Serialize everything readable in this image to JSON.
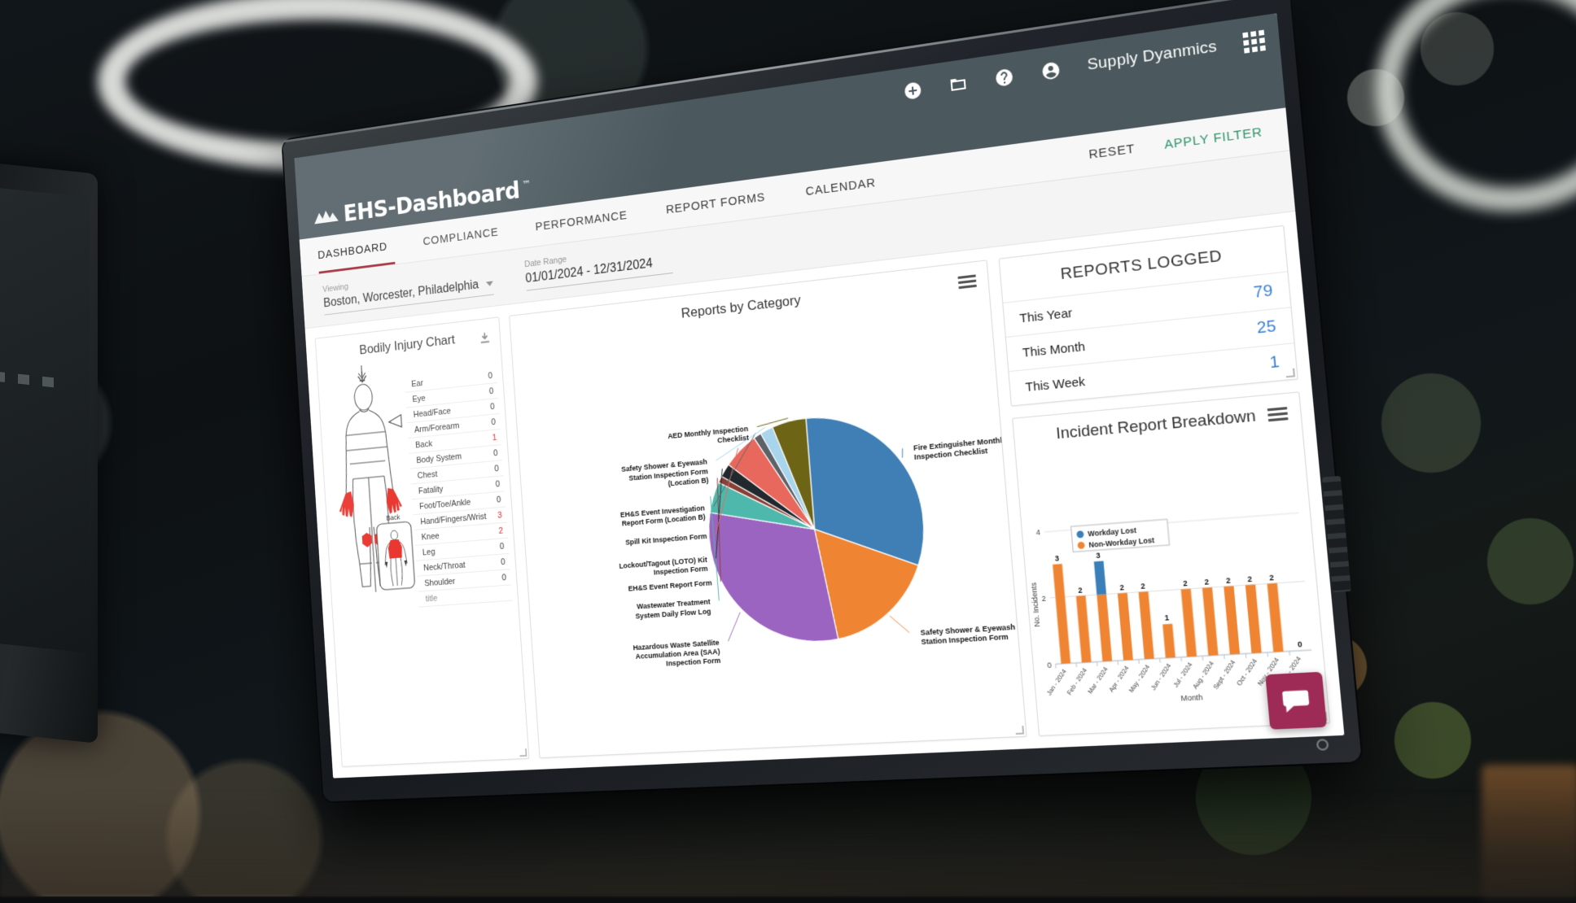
{
  "topbar": {
    "org_name": "Supply Dyanmics",
    "icons": [
      "add-circle-icon",
      "folder-icon",
      "help-circle-icon",
      "account-circle-icon",
      "apps-grid-icon"
    ]
  },
  "brand": {
    "name": "EHS-Dashboard",
    "tm": "™"
  },
  "nav": {
    "tabs": [
      {
        "label": "DASHBOARD",
        "active": true
      },
      {
        "label": "COMPLIANCE",
        "active": false
      },
      {
        "label": "PERFORMANCE",
        "active": false
      },
      {
        "label": "REPORT FORMS",
        "active": false
      },
      {
        "label": "CALENDAR",
        "active": false
      }
    ],
    "reset_label": "RESET",
    "apply_label": "APPLY FILTER"
  },
  "filters": {
    "viewing_label": "Viewing",
    "viewing_value": "Boston, Worcester, Philadelphia",
    "daterange_label": "Date Range",
    "daterange_value": "01/01/2024 - 12/31/2024"
  },
  "injury_card": {
    "title": "Bodily Injury Chart",
    "back_label": "Back",
    "footer_row": "title",
    "rows": [
      {
        "part": "Ear",
        "count": "0",
        "hot": false
      },
      {
        "part": "Eye",
        "count": "0",
        "hot": false
      },
      {
        "part": "Head/Face",
        "count": "0",
        "hot": false
      },
      {
        "part": "Arm/Forearm",
        "count": "0",
        "hot": false
      },
      {
        "part": "Back",
        "count": "1",
        "hot": true
      },
      {
        "part": "Body System",
        "count": "0",
        "hot": false
      },
      {
        "part": "Chest",
        "count": "0",
        "hot": false
      },
      {
        "part": "Fatality",
        "count": "0",
        "hot": false
      },
      {
        "part": "Foot/Toe/Ankle",
        "count": "0",
        "hot": false
      },
      {
        "part": "Hand/Fingers/Wrist",
        "count": "3",
        "hot": true
      },
      {
        "part": "Knee",
        "count": "2",
        "hot": true
      },
      {
        "part": "Leg",
        "count": "0",
        "hot": false
      },
      {
        "part": "Neck/Throat",
        "count": "0",
        "hot": false
      },
      {
        "part": "Shoulder",
        "count": "0",
        "hot": false
      }
    ]
  },
  "reports_logged": {
    "title": "REPORTS LOGGED",
    "rows": [
      {
        "label": "This Year",
        "value": "79"
      },
      {
        "label": "This Month",
        "value": "25"
      },
      {
        "label": "This Week",
        "value": "1"
      }
    ],
    "value_color": "#3a7fd5"
  },
  "chat": {
    "icon": "chat-bubble-icon",
    "color": "#9e2a56"
  },
  "chart_data": [
    {
      "id": "reports-by-category",
      "type": "pie",
      "title": "Reports by Category",
      "labels": [
        "Fire Extinguisher Monthly Inspection Checklist",
        "Safety Shower & Eyewash Station Inspection Form",
        "Hazardous Waste Satellite Accumulation Area (SAA) Inspection Form",
        "Wastewater Treatment System Daily Flow Log",
        "EH&S Event Report Form",
        "Lockout/Tagout (LOTO) Kit Inspection Form",
        "Spill Kit Inspection Form",
        "EH&S Event Investigation Report Form (Location B)",
        "Safety Shower & Eyewash Station Inspection Form (Location B)",
        "AED Monthly Inspection Checklist"
      ],
      "values": [
        31.5,
        16.5,
        31.0,
        4.6,
        1.0,
        2.0,
        5.5,
        1.2,
        2.0,
        5.2
      ],
      "colors": [
        "#3f7fb5",
        "#ef8432",
        "#9b64c0",
        "#4fb8ac",
        "#8a3f35",
        "#22292e",
        "#e8685e",
        "#5d6268",
        "#a8d5ec",
        "#6e6416"
      ],
      "legend": "labels-with-leader-lines"
    },
    {
      "id": "incident-report-breakdown",
      "type": "bar",
      "title": "Incident Report Breakdown",
      "xlabel": "Month",
      "ylabel": "No. Incidents",
      "ylim": [
        0,
        4
      ],
      "yticks": [
        "0",
        "2",
        "4"
      ],
      "categories": [
        "Jan - 2024",
        "Feb - 2024",
        "Mar - 2024",
        "Apr - 2024",
        "May - 2024",
        "Jun - 2024",
        "Jul - 2024",
        "Aug - 2024",
        "Sept - 2024",
        "Oct - 2024",
        "Nov - 2024",
        "Dec - 2024"
      ],
      "totals": [
        "3",
        "2",
        "3",
        "2",
        "2",
        "1",
        "2",
        "2",
        "2",
        "2",
        "2",
        "0"
      ],
      "series": [
        {
          "name": "Non-Workday Lost",
          "color": "#ef8432",
          "values": [
            3,
            2,
            2,
            2,
            2,
            1,
            2,
            2,
            2,
            2,
            2,
            0
          ]
        },
        {
          "name": "Workday Lost",
          "color": "#3a7fb8",
          "values": [
            0,
            0,
            1,
            0,
            0,
            0,
            0,
            0,
            0,
            0,
            0,
            0
          ]
        }
      ],
      "grid": true,
      "legend_position": "top-left"
    }
  ]
}
